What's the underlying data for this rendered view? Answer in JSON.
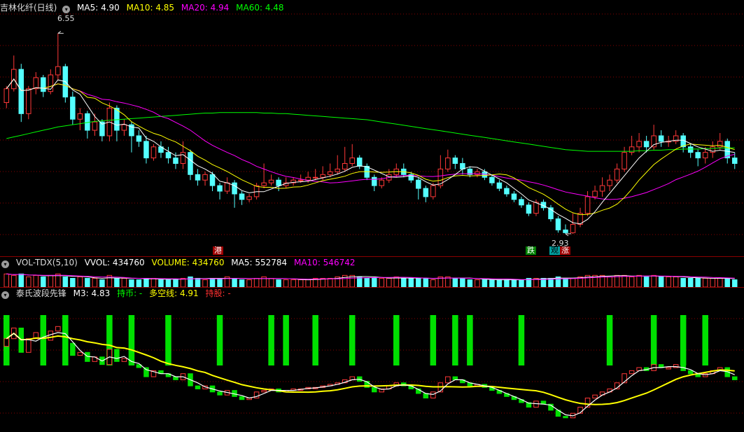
{
  "main": {
    "title": "吉林化纤(日线)",
    "indicators": [
      {
        "label": "MA5: 4.90",
        "color": "#ffffff"
      },
      {
        "label": "MA10: 4.85",
        "color": "#ffff00"
      },
      {
        "label": "MA20: 4.94",
        "color": "#ff00ff"
      },
      {
        "label": "MA60: 4.48",
        "color": "#00ff00"
      }
    ],
    "high_label": "6.55",
    "low_label": "2.93",
    "signal_gang": "港",
    "signal_die": "跌",
    "signal_guan": "观",
    "signal_zhang": "涨"
  },
  "vol": {
    "title": "VOL-TDX(5,10)",
    "indicators": [
      {
        "label": "VVOL: 434760",
        "color": "#ffffff"
      },
      {
        "label": "VOLUME: 434760",
        "color": "#ffff00"
      },
      {
        "label": "MA5: 552784",
        "color": "#ffffff"
      },
      {
        "label": "MA10: 546742",
        "color": "#ff00ff"
      }
    ]
  },
  "ind": {
    "title": "泰氏波段先锋",
    "indicators": [
      {
        "label": "M3: 4.83",
        "color": "#ffffff"
      },
      {
        "label": "持币: -",
        "color": "#00ff00"
      },
      {
        "label": "多空线: 4.91",
        "color": "#ffff00"
      },
      {
        "label": "持股: -",
        "color": "#ff3030"
      }
    ]
  },
  "colors": {
    "up": "#ff3838",
    "down": "#54ffff",
    "ma5": "#ffffff",
    "ma10": "#ffff00",
    "ma20": "#ff00ff",
    "ma60": "#00ff00",
    "grid": "#8a0000",
    "hold_bar": "#00e000"
  },
  "chart_data": {
    "type": "candlestick",
    "price_range": [
      2.6,
      6.9
    ],
    "close": [
      5.55,
      5.9,
      5.1,
      5.55,
      5.75,
      5.5,
      5.8,
      5.95,
      5.4,
      5.0,
      5.1,
      4.8,
      4.95,
      4.7,
      5.2,
      4.8,
      4.9,
      4.7,
      4.6,
      4.3,
      4.5,
      4.4,
      4.3,
      4.2,
      4.4,
      4.0,
      3.9,
      4.0,
      3.8,
      3.7,
      3.85,
      3.65,
      3.55,
      3.6,
      3.8,
      3.85,
      3.9,
      3.8,
      3.85,
      3.9,
      3.9,
      3.95,
      3.95,
      4.0,
      4.05,
      4.1,
      4.2,
      4.3,
      4.15,
      3.95,
      3.8,
      3.9,
      4.0,
      4.1,
      4.0,
      3.9,
      3.75,
      3.6,
      3.8,
      4.1,
      4.3,
      4.2,
      4.1,
      4.0,
      4.05,
      3.95,
      3.85,
      3.75,
      3.65,
      3.55,
      3.45,
      3.3,
      3.5,
      3.4,
      3.2,
      3.0,
      2.95,
      3.1,
      3.3,
      3.6,
      3.7,
      3.8,
      3.9,
      4.1,
      4.4,
      4.5,
      4.6,
      4.5,
      4.7,
      4.6,
      4.6,
      4.7,
      4.5,
      4.4,
      4.3,
      4.4,
      4.5,
      4.6,
      4.3,
      4.2
    ],
    "candles": [
      [
        5.3,
        5.55,
        5.6,
        5.2
      ],
      [
        5.55,
        5.9,
        6.15,
        5.5
      ],
      [
        5.9,
        5.1,
        6.0,
        4.95
      ],
      [
        5.1,
        5.55,
        5.6,
        5.0
      ],
      [
        5.55,
        5.75,
        5.85,
        5.45
      ],
      [
        5.75,
        5.5,
        5.8,
        5.4
      ],
      [
        5.5,
        5.8,
        5.9,
        5.45
      ],
      [
        5.8,
        5.95,
        6.55,
        5.7
      ],
      [
        5.95,
        5.4,
        6.0,
        5.3
      ],
      [
        5.4,
        5.0,
        5.5,
        4.9
      ],
      [
        5.0,
        5.1,
        5.2,
        4.8
      ],
      [
        5.1,
        4.8,
        5.15,
        4.65
      ],
      [
        4.8,
        4.95,
        5.1,
        4.7
      ],
      [
        4.95,
        4.7,
        5.0,
        4.6
      ],
      [
        4.7,
        5.2,
        5.3,
        4.6
      ],
      [
        5.2,
        4.8,
        5.25,
        4.6
      ],
      [
        4.8,
        4.9,
        5.0,
        4.7
      ],
      [
        4.9,
        4.7,
        4.95,
        4.4
      ],
      [
        4.7,
        4.6,
        4.8,
        4.5
      ],
      [
        4.6,
        4.3,
        4.7,
        4.2
      ],
      [
        4.3,
        4.5,
        4.55,
        4.25
      ],
      [
        4.5,
        4.4,
        4.6,
        4.3
      ],
      [
        4.4,
        4.3,
        4.5,
        4.2
      ],
      [
        4.3,
        4.2,
        4.4,
        4.1
      ],
      [
        4.2,
        4.4,
        4.6,
        4.1
      ],
      [
        4.4,
        4.0,
        4.45,
        3.9
      ],
      [
        4.0,
        3.9,
        4.1,
        3.8
      ],
      [
        3.9,
        4.0,
        4.05,
        3.8
      ],
      [
        4.0,
        3.8,
        4.05,
        3.7
      ],
      [
        3.8,
        3.7,
        3.85,
        3.55
      ],
      [
        3.7,
        3.85,
        3.95,
        3.65
      ],
      [
        3.85,
        3.65,
        3.9,
        3.4
      ],
      [
        3.65,
        3.55,
        3.7,
        3.45
      ],
      [
        3.55,
        3.6,
        3.65,
        3.5
      ],
      [
        3.6,
        3.8,
        3.85,
        3.55
      ],
      [
        3.8,
        3.85,
        4.2,
        3.75
      ],
      [
        3.85,
        3.9,
        4.0,
        3.8
      ],
      [
        3.9,
        3.8,
        3.95,
        3.7
      ],
      [
        3.8,
        3.85,
        3.95,
        3.75
      ],
      [
        3.85,
        3.9,
        3.95,
        3.8
      ],
      [
        3.9,
        3.9,
        4.0,
        3.85
      ],
      [
        3.9,
        3.95,
        4.05,
        3.85
      ],
      [
        3.95,
        3.95,
        4.1,
        3.9
      ],
      [
        3.95,
        4.0,
        4.15,
        3.9
      ],
      [
        4.0,
        4.05,
        4.2,
        3.95
      ],
      [
        4.05,
        4.1,
        4.35,
        4.0
      ],
      [
        4.1,
        4.2,
        4.5,
        4.05
      ],
      [
        4.2,
        4.3,
        4.55,
        4.15
      ],
      [
        4.3,
        4.15,
        4.35,
        4.1
      ],
      [
        4.15,
        3.95,
        4.2,
        3.9
      ],
      [
        3.95,
        3.8,
        4.0,
        3.7
      ],
      [
        3.8,
        3.9,
        3.95,
        3.75
      ],
      [
        3.9,
        4.0,
        4.1,
        3.85
      ],
      [
        4.0,
        4.1,
        4.2,
        3.95
      ],
      [
        4.1,
        4.0,
        4.2,
        3.95
      ],
      [
        4.0,
        3.9,
        4.05,
        3.85
      ],
      [
        3.9,
        3.75,
        3.95,
        3.55
      ],
      [
        3.75,
        3.6,
        3.8,
        3.5
      ],
      [
        3.6,
        3.8,
        3.85,
        3.55
      ],
      [
        3.8,
        4.1,
        4.35,
        3.75
      ],
      [
        4.1,
        4.3,
        4.45,
        4.05
      ],
      [
        4.3,
        4.2,
        4.35,
        4.1
      ],
      [
        4.2,
        4.1,
        4.3,
        4.0
      ],
      [
        4.1,
        4.0,
        4.15,
        3.95
      ],
      [
        4.0,
        4.05,
        4.1,
        3.95
      ],
      [
        4.05,
        3.95,
        4.1,
        3.9
      ],
      [
        3.95,
        3.85,
        4.0,
        3.8
      ],
      [
        3.85,
        3.75,
        3.9,
        3.7
      ],
      [
        3.75,
        3.65,
        3.8,
        3.6
      ],
      [
        3.65,
        3.55,
        3.7,
        3.5
      ],
      [
        3.55,
        3.45,
        3.6,
        3.4
      ],
      [
        3.45,
        3.3,
        3.5,
        3.25
      ],
      [
        3.3,
        3.5,
        3.55,
        3.25
      ],
      [
        3.5,
        3.4,
        3.55,
        3.35
      ],
      [
        3.4,
        3.2,
        3.45,
        3.15
      ],
      [
        3.2,
        3.0,
        3.25,
        2.95
      ],
      [
        3.0,
        2.95,
        3.1,
        2.93
      ],
      [
        2.95,
        3.1,
        3.3,
        2.93
      ],
      [
        3.1,
        3.3,
        3.4,
        3.05
      ],
      [
        3.3,
        3.6,
        3.7,
        3.25
      ],
      [
        3.6,
        3.7,
        3.8,
        3.55
      ],
      [
        3.7,
        3.8,
        3.95,
        3.6
      ],
      [
        3.8,
        3.9,
        4.0,
        3.7
      ],
      [
        3.9,
        4.1,
        4.2,
        3.85
      ],
      [
        4.1,
        4.4,
        4.5,
        4.05
      ],
      [
        4.4,
        4.5,
        4.7,
        4.35
      ],
      [
        4.5,
        4.6,
        4.75,
        4.4
      ],
      [
        4.6,
        4.5,
        4.7,
        4.4
      ],
      [
        4.5,
        4.7,
        4.9,
        4.45
      ],
      [
        4.7,
        4.6,
        4.8,
        4.5
      ],
      [
        4.6,
        4.6,
        4.7,
        4.5
      ],
      [
        4.6,
        4.7,
        4.8,
        4.55
      ],
      [
        4.7,
        4.5,
        4.75,
        4.4
      ],
      [
        4.5,
        4.4,
        4.55,
        4.3
      ],
      [
        4.4,
        4.3,
        4.45,
        4.15
      ],
      [
        4.3,
        4.4,
        4.5,
        4.2
      ],
      [
        4.4,
        4.5,
        4.6,
        4.3
      ],
      [
        4.5,
        4.6,
        4.75,
        4.45
      ],
      [
        4.6,
        4.3,
        4.65,
        4.2
      ],
      [
        4.3,
        4.2,
        4.4,
        4.1
      ]
    ],
    "ma60": [
      4.65,
      4.68,
      4.71,
      4.74,
      4.77,
      4.8,
      4.83,
      4.86,
      4.88,
      4.9,
      4.92,
      4.94,
      4.96,
      4.97,
      4.98,
      4.99,
      5.0,
      5.01,
      5.02,
      5.03,
      5.04,
      5.05,
      5.06,
      5.07,
      5.08,
      5.09,
      5.1,
      5.11,
      5.11,
      5.12,
      5.12,
      5.12,
      5.12,
      5.12,
      5.12,
      5.11,
      5.11,
      5.1,
      5.1,
      5.09,
      5.08,
      5.07,
      5.06,
      5.05,
      5.04,
      5.03,
      5.02,
      5.01,
      5.0,
      4.99,
      4.97,
      4.95,
      4.93,
      4.91,
      4.89,
      4.87,
      4.85,
      4.83,
      4.81,
      4.79,
      4.77,
      4.75,
      4.73,
      4.71,
      4.69,
      4.67,
      4.65,
      4.63,
      4.61,
      4.59,
      4.57,
      4.55,
      4.53,
      4.51,
      4.49,
      4.47,
      4.45,
      4.44,
      4.43,
      4.42,
      4.42,
      4.42,
      4.42,
      4.42,
      4.42,
      4.42,
      4.43,
      4.43,
      4.44,
      4.44,
      4.45,
      4.45,
      4.46,
      4.46,
      4.46,
      4.47,
      4.47,
      4.48,
      4.48,
      4.48
    ],
    "volume": [
      9,
      8,
      9,
      7,
      8,
      7,
      8,
      9,
      7,
      6,
      7,
      6,
      6,
      5,
      8,
      6,
      6,
      5,
      5,
      6,
      6,
      5,
      5,
      5,
      6,
      7,
      6,
      5,
      6,
      6,
      7,
      6,
      5,
      5,
      6,
      7,
      6,
      5,
      5,
      5,
      5,
      5,
      6,
      6,
      6,
      7,
      8,
      8,
      7,
      6,
      6,
      6,
      6,
      7,
      6,
      6,
      6,
      6,
      5,
      7,
      7,
      6,
      6,
      5,
      5,
      5,
      5,
      5,
      5,
      5,
      5,
      6,
      6,
      6,
      6,
      7,
      6,
      6,
      7,
      8,
      8,
      8,
      7,
      8,
      8,
      7,
      8,
      7,
      8,
      7,
      7,
      7,
      6,
      6,
      6,
      6,
      6,
      6,
      6,
      5
    ],
    "vol_range": [
      0,
      12
    ],
    "hold_bars": [
      0,
      5,
      8,
      14,
      17,
      22,
      29,
      36,
      38,
      42,
      47,
      53,
      58,
      61,
      63,
      70,
      82,
      88,
      92,
      95,
      102
    ],
    "ind_range": [
      2.6,
      6.9
    ]
  }
}
